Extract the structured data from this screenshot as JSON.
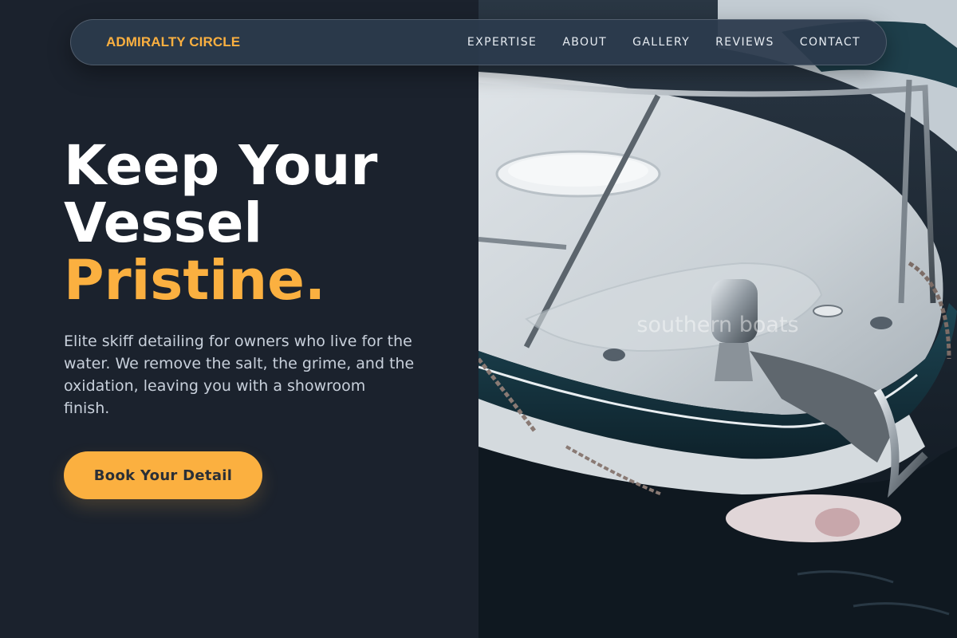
{
  "brand": {
    "name": "ADMIRALTY CIRCLE",
    "accent_color": "#fbb040"
  },
  "nav": {
    "items": [
      {
        "label": "EXPERTISE"
      },
      {
        "label": "ABOUT"
      },
      {
        "label": "GALLERY"
      },
      {
        "label": "REVIEWS"
      },
      {
        "label": "CONTACT"
      }
    ]
  },
  "hero": {
    "title_line1": "Keep Your",
    "title_line2": "Vessel",
    "title_accent": "Pristine.",
    "subtitle": "Elite skiff detailing for owners who live for the water. We remove the salt, the grime, and the oxidation, leaving you with a showroom finish.",
    "cta_label": "Book Your Detail"
  },
  "photo": {
    "watermark": "southern boats"
  },
  "colors": {
    "background": "#1b222d",
    "accent": "#fbb040",
    "text": "#ffffff"
  }
}
